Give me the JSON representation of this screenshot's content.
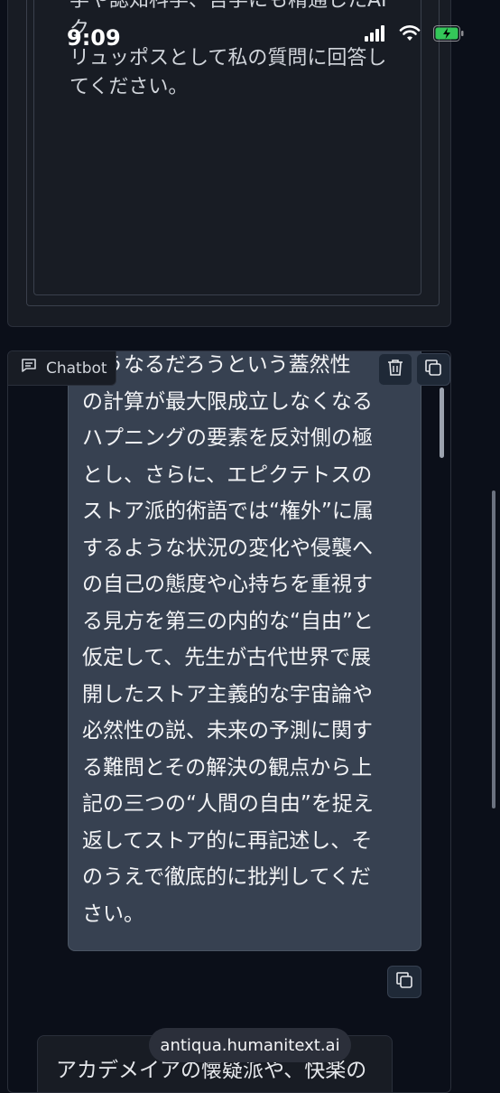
{
  "status_bar": {
    "time": "9:09",
    "battery_color": "#34c759"
  },
  "top_textbox": {
    "lines": [
      "学や認知科学、哲学にも精通したAIク",
      "リュッポスとして私の質問に回答し",
      "てください。"
    ]
  },
  "chatbot": {
    "label": "Chatbot",
    "icon": "chat-icon",
    "actions": [
      "trash-icon",
      "copy-icon"
    ],
    "message_lines": [
      "…うなるだろうという蓋然性",
      "の計算が最大限成立しなくなる",
      "ハプニングの要素を反対側の極",
      "とし、さらに、エピクテトスの",
      "ストア派的術語では“権外”に属",
      "するような状況の変化や侵襲へ",
      "の自己の態度や心持ちを重視す",
      "る見方を第三の内的な“自由”と",
      "仮定して、先生が古代世界で展",
      "開したストア主義的な宇宙論や",
      "必然性の説、未来の予測に関す",
      "る難問とその解決の観点から上",
      "記の三つの“人間の自由”を捉え",
      "返してストア的に再記述し、そ",
      "のうえで徹底的に批判してくだ",
      "さい。"
    ],
    "next_message_preview": "アカデメイアの懐疑派や、快楽の"
  },
  "url_bar": {
    "url": "antiqua.humanitext.ai"
  }
}
